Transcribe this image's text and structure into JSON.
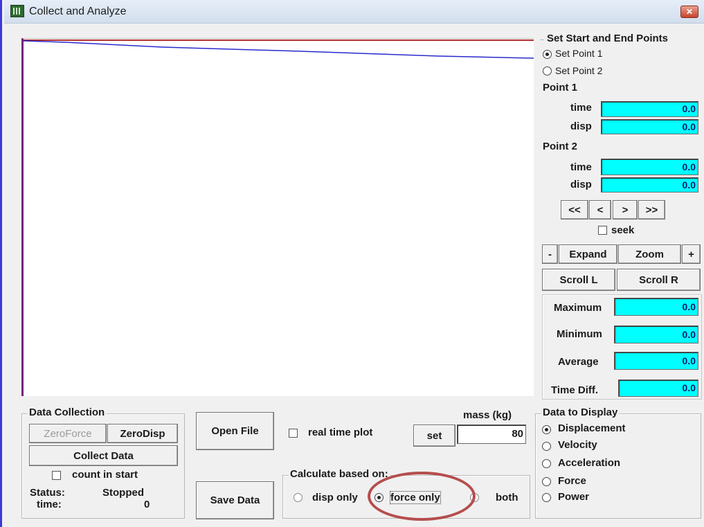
{
  "window": {
    "title": "Collect and Analyze",
    "close_icon": "close-icon"
  },
  "colors": {
    "accent_field": "#00ffff",
    "plot_line_red": "#b03030",
    "plot_line_blue": "#2a2acc",
    "annotation_oval": "#b54d4d"
  },
  "set_points": {
    "title": "Set Start and End Points",
    "radio1": "Set Point 1",
    "radio2": "Set Point 2",
    "point1": {
      "label": "Point 1",
      "time_label": "time",
      "time_value": "0.0",
      "disp_label": "disp",
      "disp_value": "0.0"
    },
    "point2": {
      "label": "Point 2",
      "time_label": "time",
      "time_value": "0.0",
      "disp_label": "disp",
      "disp_value": "0.0"
    },
    "nav": {
      "first": "<<",
      "prev": "<",
      "next": ">",
      "last": ">>"
    },
    "seek_label": "seek",
    "minus": "-",
    "expand": "Expand",
    "zoom": "Zoom",
    "plus": "+",
    "scroll_l": "Scroll L",
    "scroll_r": "Scroll R"
  },
  "stats": {
    "maximum_label": "Maximum",
    "maximum_value": "0.0",
    "minimum_label": "Minimum",
    "minimum_value": "0.0",
    "average_label": "Average",
    "average_value": "0.0",
    "timediff_label": "Time Diff.",
    "timediff_value": "0.0"
  },
  "data_collection": {
    "title": "Data Collection",
    "zero_force": "ZeroForce",
    "zero_disp": "ZeroDisp",
    "collect_data": "Collect Data",
    "count_in_start": "count in start",
    "status_label": "Status:",
    "status_value": "Stopped",
    "time_label": "time:",
    "time_value": "0"
  },
  "file": {
    "open_file": "Open File",
    "save_data": "Save Data"
  },
  "realtime": {
    "label": "real time plot"
  },
  "mass": {
    "label": "mass (kg)",
    "set": "set",
    "value": "80"
  },
  "calculate": {
    "title": "Calculate based on:",
    "disp_only": "disp only",
    "force_only": "force only",
    "both": "both"
  },
  "display": {
    "title": "Data to Display",
    "options": [
      "Displacement",
      "Velocity",
      "Acceleration",
      "Force",
      "Power"
    ]
  }
}
